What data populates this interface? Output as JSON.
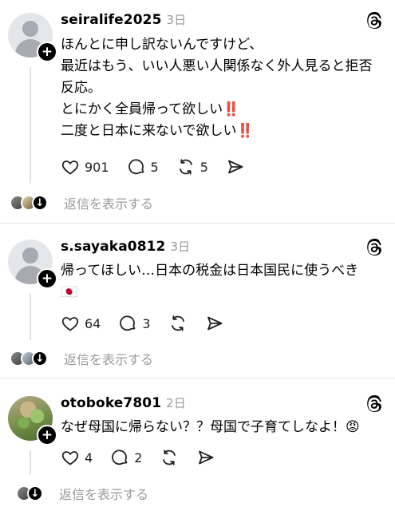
{
  "posts": [
    {
      "username": "seiralife2025",
      "time": "3日",
      "text": "ほんとに申し訳ないんですけど、\n最近はもう、いい人悪い人関係なく外人見ると拒否反応。\nとにかく全員帰って欲しい‼️\n二度と日本に来ないで欲しい‼️",
      "likes": "901",
      "comments": "5",
      "reposts": "5",
      "shares": "",
      "replies_label": "返信を表示する"
    },
    {
      "username": "s.sayaka0812",
      "time": "3日",
      "text": "帰ってほしい…日本の税金は日本国民に使うべき\n🇯🇵",
      "likes": "64",
      "comments": "3",
      "reposts": "",
      "shares": "",
      "replies_label": "返信を表示する"
    },
    {
      "username": "otoboke7801",
      "time": "2日",
      "text": "なぜ母国に帰らない？？母国で子育てしなよ！😡",
      "likes": "4",
      "comments": "2",
      "reposts": "",
      "shares": "",
      "replies_label": "返信を表示する"
    }
  ],
  "icons": {
    "like": "heart-icon",
    "comment": "comment-bubble-icon",
    "repost": "repost-icon",
    "share": "send-icon",
    "brand": "threads-icon",
    "follow": "plus-icon",
    "expand": "arrow-down-icon"
  }
}
